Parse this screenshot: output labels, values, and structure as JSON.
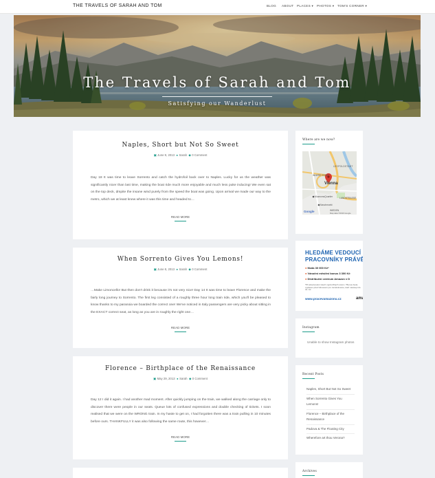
{
  "site": {
    "brand": "THE TRAVELS OF SARAH AND TOM"
  },
  "nav": {
    "items": [
      {
        "label": "BLOG",
        "caret": ""
      },
      {
        "label": "ABOUT",
        "caret": ""
      },
      {
        "label": "PLACES",
        "caret": "▾"
      },
      {
        "label": "PHOTOS",
        "caret": "▾"
      },
      {
        "label": "TOM'S CORNER",
        "caret": "▾"
      }
    ]
  },
  "hero": {
    "title": "The Travels of Sarah and Tom",
    "subtitle": "Satisfying our Wanderlust"
  },
  "posts": [
    {
      "title": "Naples, Short but Not So Sweet",
      "date": "June 9, 2013",
      "author": "Sarah",
      "comments": "0 Comment",
      "excerpt": "Day 18 It was time to leave Sorrento and catch the hydrofoil back over to Naples. Lucky for us the weather was significantly nicer than last time, making the boat ride much more enjoyable and much less puke inducing! We even sat on the top deck, dmpite the insane wind purely from the speed the boat was going. Upon arrival we made our way to the metro, which we at least knew where it was this time and headed to…",
      "read_more": "READ MORE"
    },
    {
      "title": "When Sorrento Gives You Lemons!",
      "date": "June 8, 2013",
      "author": "Sarah",
      "comments": "0 Comment",
      "excerpt": "…Make Limoncello! But then don't drink it because it's not very nice! Day 14 It was time to leave Florence and make the fairly long journey to Sorrento. The first leg consisted of a roughly three hour long train ride, which you'll be pleased to know thanks to my paranoia we boarded the correct one! We've noticed in Italy passengers are very picky about sitting in the EXACT correct seat, as long as you are in roughly the right one…",
      "read_more": "READ MORE"
    },
    {
      "title": "Florence – Birthplace of the Renaissance",
      "date": "May 29, 2013",
      "author": "Sarah",
      "comments": "0 Comment",
      "excerpt": "Day 12 I did it again. I had another mad moment. After quickly jumping on the train, we walked along the carriage only to discover there were people in our seats. Queue lots of confused expressions and double checking of tickets. I soon realised that we were on the WRONG train. In my haste to get on, I had forgotten there was a train pulling in 10 minutes before ours. THANKFULLY it was also following the same route, this however…",
      "read_more": "READ MORE"
    }
  ],
  "sidebar": {
    "map_widget": {
      "title": "Where are we now?",
      "labels": {
        "city": "Vienna",
        "district_top": "LEOPOLDSTADT",
        "district_left": "INNERE STADT",
        "district_right": "LANDSTRASSE",
        "district_bottom": "WIEDEN",
        "poi1": "MuseumsQuartier",
        "poi2": "Naschmarkt",
        "attribution": "Map data ©2016 Google",
        "google": "Google"
      }
    },
    "ad": {
      "line1": "HLEDÁME VEDOUCÍ",
      "line2": "PRACOVNÍKY PRÁVĚ",
      "bullets": [
        "Mzda 30 000 Kč*",
        "Vánoční měsíční bonus 3 300 Kč",
        "Distribuční centrum Amazon v D"
      ],
      "fine": "*Při absolvování všech nepřetržitých směn • *Bonus bude vyplacen před Vánocemi pro zaměstnance, kteří nastoupí do 31. 10.",
      "url": "www.pracevamazonu.cz",
      "logo": "ama"
    },
    "instagram": {
      "title": "Instagram",
      "text": "Unable to show Instagram photos"
    },
    "recent_posts": {
      "title": "Recent Posts",
      "items": [
        "Naples, Short But Not So Sweet",
        "When Sorrento Gives You Lemons!",
        "Florence – Birthplace of the Renaissance",
        "Padova & The Floating City",
        "Wherefore art thou Verona?"
      ]
    },
    "archives": {
      "title": "Archives"
    }
  },
  "colors": {
    "accent": "#1b9b8a",
    "background": "#eef0f3"
  }
}
